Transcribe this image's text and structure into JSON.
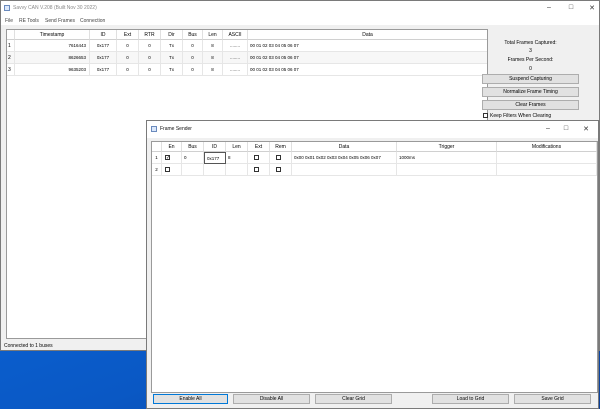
{
  "main": {
    "title": "Savvy CAN V.208 (Built Nov 30 2022)",
    "menu": [
      "File",
      "RE Tools",
      "Send Frames",
      "Connection"
    ],
    "columns": [
      "Timestamp",
      "ID",
      "Ext",
      "RTR",
      "Dir",
      "Bus",
      "Len",
      "ASCII",
      "Data"
    ],
    "rows": [
      {
        "n": "1",
        "ts": "7616443",
        "id": "0x177",
        "ext": "0",
        "rtr": "0",
        "dir": "Tx",
        "bus": "0",
        "len": "8",
        "ascii": "........",
        "data": "00 01 02 03 04 05 06 07"
      },
      {
        "n": "2",
        "ts": "8626653",
        "id": "0x177",
        "ext": "0",
        "rtr": "0",
        "dir": "Tx",
        "bus": "0",
        "len": "8",
        "ascii": "........",
        "data": "00 01 02 03 04 05 06 07"
      },
      {
        "n": "3",
        "ts": "9635203",
        "id": "0x177",
        "ext": "0",
        "rtr": "0",
        "dir": "Tx",
        "bus": "0",
        "len": "8",
        "ascii": "........",
        "data": "00 01 02 03 04 05 06 07"
      }
    ],
    "side": {
      "total_label": "Total Frames Captured:",
      "total_value": "3",
      "fps_label": "Frames Per Second:",
      "fps_value": "0",
      "suspend": "Suspend Capturing",
      "normalize": "Normalize Frame Timing",
      "clear": "Clear Frames",
      "keep_filters": "Keep Filters When Clearing"
    },
    "status": "Connected to 1 buses"
  },
  "sender": {
    "title": "Frame Sender",
    "columns": [
      "En",
      "Bus",
      "ID",
      "Len",
      "Ext",
      "Rem",
      "Data",
      "Trigger",
      "Modifications"
    ],
    "rows": [
      {
        "n": "1",
        "en": true,
        "bus": "0",
        "id": "0x177",
        "len": "8",
        "ext": false,
        "rem": false,
        "data": "0x00 0x01 0x02 0x03 0x04 0x05 0x06 0x07",
        "trigger": "1000ms",
        "mods": ""
      },
      {
        "n": "2",
        "en": false,
        "bus": "",
        "id": "",
        "len": "",
        "ext": false,
        "rem": false,
        "data": "",
        "trigger": "",
        "mods": ""
      }
    ],
    "buttons": {
      "enable_all": "Enable All",
      "disable_all": "Disable All",
      "clear_grid": "Clear Grid",
      "load_grid": "Load to Grid",
      "save_grid": "Save Grid"
    }
  },
  "colors": {
    "desktop": "#0b5cd0",
    "window": "#f0f0f0",
    "accent": "#0078d7"
  }
}
